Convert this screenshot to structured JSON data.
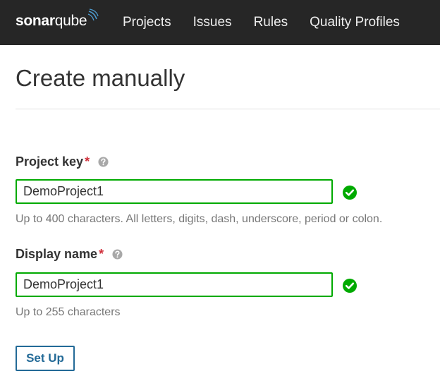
{
  "brand": {
    "name_bold": "sonar",
    "name_regular": "qube"
  },
  "nav": {
    "items": [
      {
        "label": "Projects"
      },
      {
        "label": "Issues"
      },
      {
        "label": "Rules"
      },
      {
        "label": "Quality Profiles"
      }
    ]
  },
  "page": {
    "title": "Create manually"
  },
  "form": {
    "project_key": {
      "label": "Project key",
      "required_mark": "*",
      "value": "DemoProject1",
      "hint": "Up to 400 characters. All letters, digits, dash, underscore, period or colon."
    },
    "display_name": {
      "label": "Display name",
      "required_mark": "*",
      "value": "DemoProject1",
      "hint": "Up to 255 characters"
    },
    "submit_label": "Set Up"
  },
  "colors": {
    "topbar": "#262626",
    "valid_border": "#00aa00",
    "check": "#00aa00",
    "required": "#d02f3a",
    "button": "#236a97"
  }
}
